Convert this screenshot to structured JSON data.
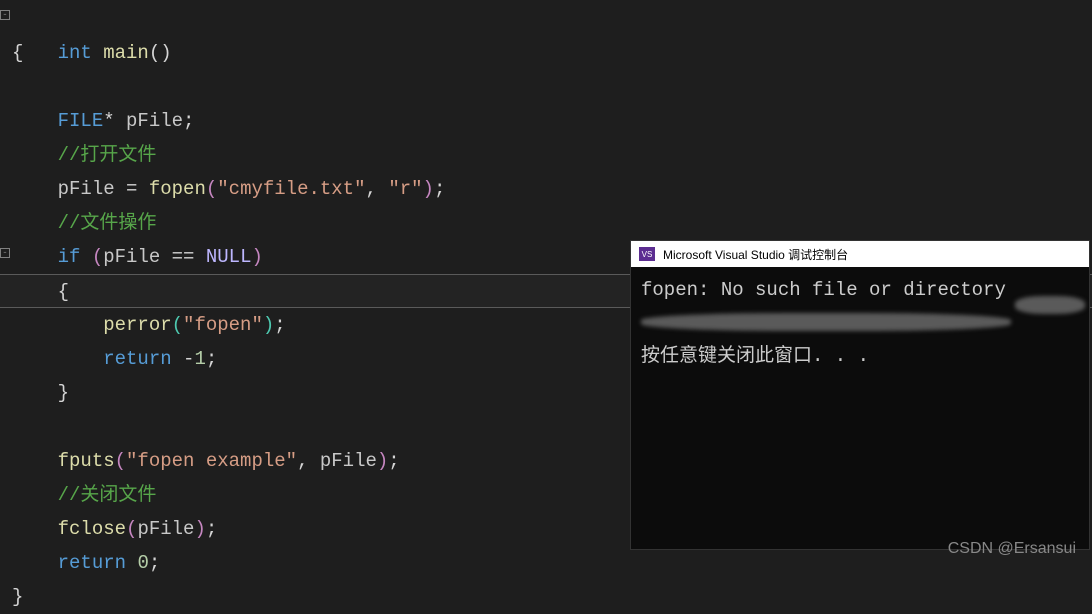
{
  "code": {
    "l1_int": "int",
    "l1_main": " main",
    "l1_paren": "()",
    "l2": "{",
    "l4_type": "    FILE",
    "l4_star": "* ",
    "l4_var": "pFile",
    "l4_semi": ";",
    "l5": "    //打开文件",
    "l6_var": "    pFile ",
    "l6_eq": "= ",
    "l6_fn": "fopen",
    "l6_open": "(",
    "l6_str1": "\"cmyfile.txt\"",
    "l6_comma": ", ",
    "l6_str2": "\"r\"",
    "l6_close": ")",
    "l6_semi": ";",
    "l7": "    //文件操作",
    "l8_if": "    if ",
    "l8_open": "(",
    "l8_var": "pFile ",
    "l8_eq": "== ",
    "l8_null": "NULL",
    "l8_close": ")",
    "l9": "    {",
    "l10_pad": "        ",
    "l10_fn": "perror",
    "l10_open": "(",
    "l10_str": "\"fopen\"",
    "l10_close": ")",
    "l10_semi": ";",
    "l11_pad": "        ",
    "l11_ret": "return",
    "l11_sp": " ",
    "l11_neg": "-",
    "l11_num": "1",
    "l11_semi": ";",
    "l12": "    }",
    "l14_pad": "    ",
    "l14_fn": "fputs",
    "l14_open": "(",
    "l14_str": "\"fopen example\"",
    "l14_comma": ", ",
    "l14_var": "pFile",
    "l14_close": ")",
    "l14_semi": ";",
    "l15": "    //关闭文件",
    "l16_pad": "    ",
    "l16_fn": "fclose",
    "l16_open": "(",
    "l16_var": "pFile",
    "l16_close": ")",
    "l16_semi": ";",
    "l17_pad": "    ",
    "l17_ret": "return",
    "l17_sp": " ",
    "l17_num": "0",
    "l17_semi": ";",
    "l18": "}"
  },
  "console": {
    "icon_text": "VS",
    "title": "Microsoft Visual Studio 调试控制台",
    "line1": "fopen: No such file or directory",
    "line3": "按任意键关闭此窗口. . ."
  },
  "watermark": "CSDN @Ersansui"
}
